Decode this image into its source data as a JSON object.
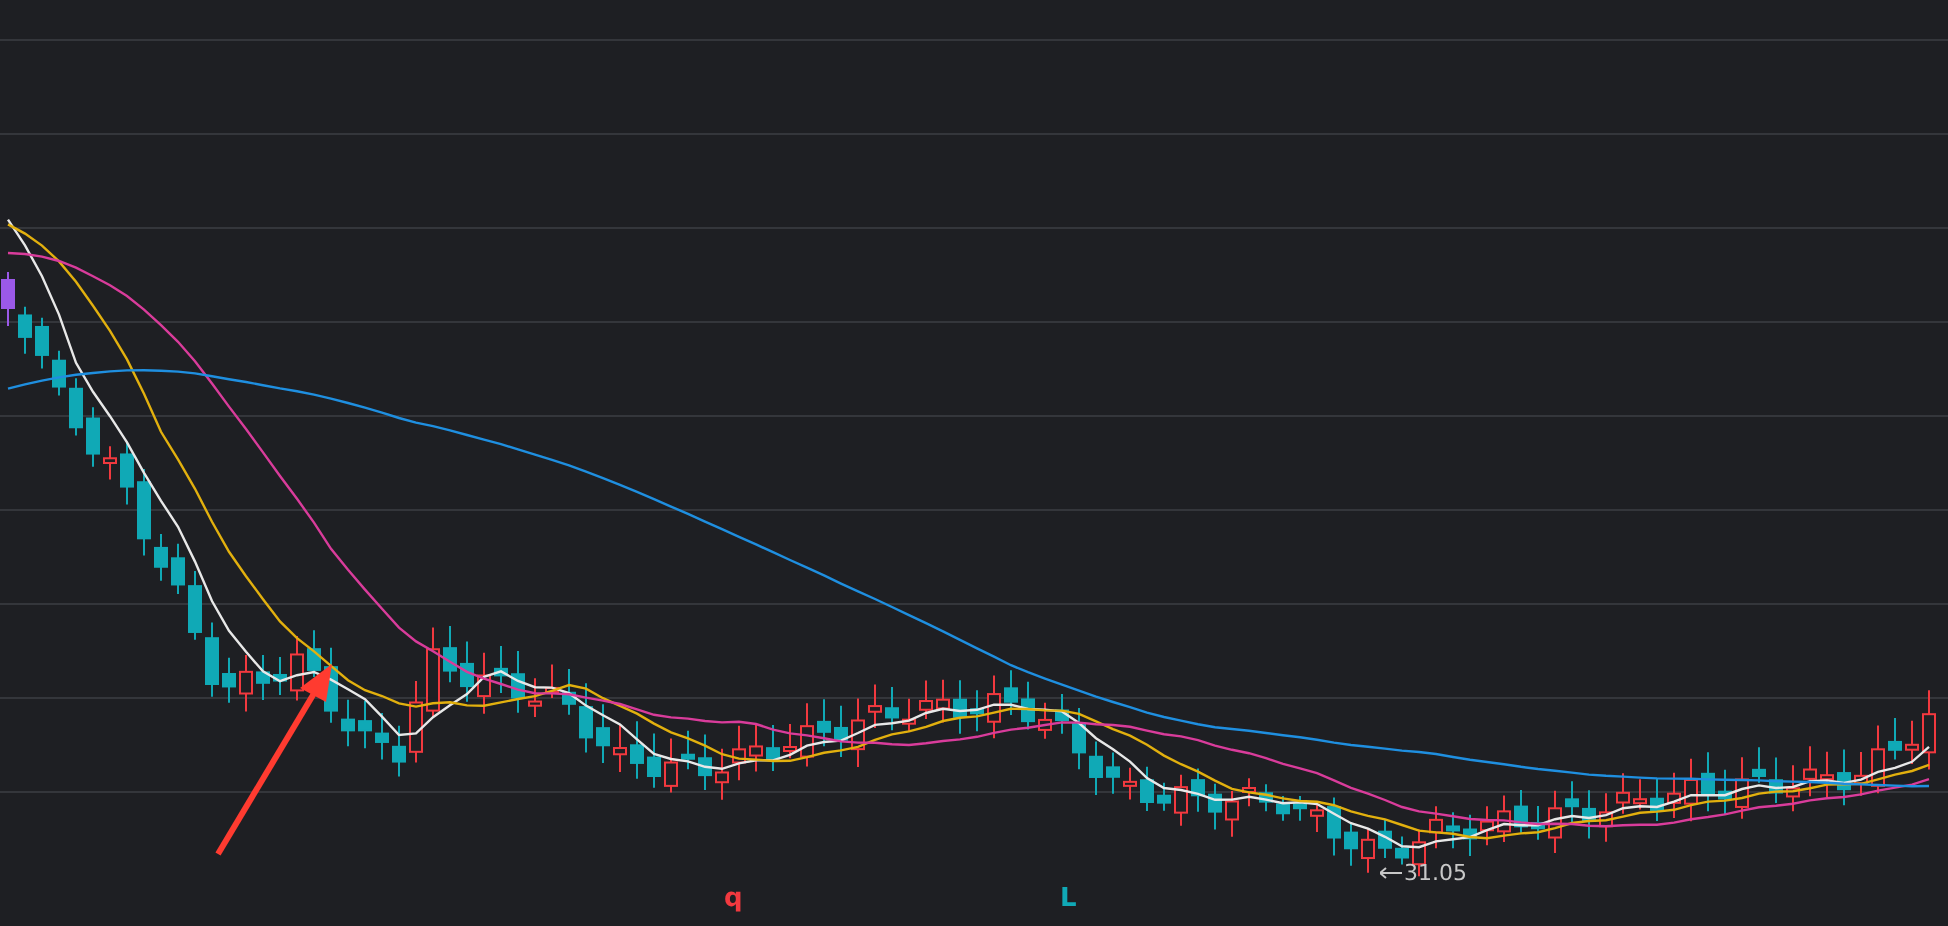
{
  "chart": {
    "low_marker": "31.05",
    "markers": [
      {
        "label": "q",
        "color": "#f2393f"
      },
      {
        "label": "L",
        "color": "#10a9b6"
      }
    ]
  }
}
